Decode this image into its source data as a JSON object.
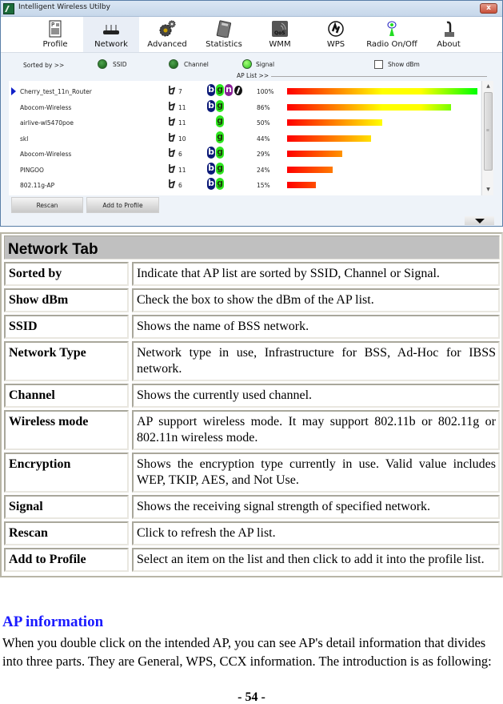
{
  "window": {
    "title": "Intelligent Wireless Utilby",
    "close_label": "x"
  },
  "toolbar": {
    "items": [
      {
        "label": "Profile",
        "icon": "profile-icon"
      },
      {
        "label": "Network",
        "icon": "router-icon",
        "active": true
      },
      {
        "label": "Advanced",
        "icon": "gears-icon"
      },
      {
        "label": "Statistics",
        "icon": "calculator-icon"
      },
      {
        "label": "WMM",
        "icon": "qos-icon"
      },
      {
        "label": "WPS",
        "icon": "wps-icon"
      },
      {
        "label": "Radio On/Off",
        "icon": "radio-antenna-icon"
      },
      {
        "label": "About",
        "icon": "about-icon"
      }
    ]
  },
  "sortbar": {
    "sorted_by_label": "Sorted by >>",
    "options": [
      {
        "label": "SSID",
        "selected": false
      },
      {
        "label": "Channel",
        "selected": false
      },
      {
        "label": "Signal",
        "selected": true
      }
    ],
    "show_dbm_label": "Show dBm",
    "show_dbm_checked": false,
    "ap_list_label": "AP List >>"
  },
  "ap_list": [
    {
      "ssid": "Cherry_test_11n_Router",
      "channel": "7",
      "modes": [
        "b",
        "g",
        "n"
      ],
      "secured": true,
      "signal_pct": 100,
      "signal_label": "100%",
      "selected": true
    },
    {
      "ssid": "Abocom-Wireless",
      "channel": "11",
      "modes": [
        "b",
        "g"
      ],
      "secured": false,
      "signal_pct": 86,
      "signal_label": "86%"
    },
    {
      "ssid": "airlive-wl5470poe",
      "channel": "11",
      "modes": [
        "g"
      ],
      "secured": false,
      "signal_pct": 50,
      "signal_label": "50%"
    },
    {
      "ssid": "skl",
      "channel": "10",
      "modes": [
        "g"
      ],
      "secured": false,
      "signal_pct": 44,
      "signal_label": "44%"
    },
    {
      "ssid": "Abocom-Wireless",
      "channel": "6",
      "modes": [
        "b",
        "g"
      ],
      "secured": false,
      "signal_pct": 29,
      "signal_label": "29%"
    },
    {
      "ssid": "PINGOO",
      "channel": "11",
      "modes": [
        "b",
        "g"
      ],
      "secured": false,
      "signal_pct": 24,
      "signal_label": "24%"
    },
    {
      "ssid": "802.11g-AP",
      "channel": "6",
      "modes": [
        "b",
        "g"
      ],
      "secured": false,
      "signal_pct": 15,
      "signal_label": "15%"
    }
  ],
  "buttons": {
    "rescan": "Rescan",
    "add_to_profile": "Add to Profile"
  },
  "table": {
    "title": "Network Tab",
    "rows": [
      {
        "key": "Sorted by",
        "value": "Indicate that AP list are sorted by SSID, Channel or Signal."
      },
      {
        "key": "Show dBm",
        "value": "Check the box to show the dBm of the AP list."
      },
      {
        "key": "SSID",
        "value": "Shows the name of BSS network."
      },
      {
        "key": "Network Type",
        "value": "Network type in use, Infrastructure for BSS, Ad-Hoc for IBSS network."
      },
      {
        "key": "Channel",
        "value": "Shows the currently used channel."
      },
      {
        "key": "Wireless mode",
        "value": "AP support wireless mode. It may support 802.11b or 802.11g or 802.11n wireless mode."
      },
      {
        "key": "Encryption",
        "value": "Shows the encryption type currently in use. Valid value includes WEP, TKIP, AES, and Not Use."
      },
      {
        "key": "Signal",
        "value": "Shows the receiving signal strength of specified network."
      },
      {
        "key": "Rescan",
        "value": "Click to refresh the AP list."
      },
      {
        "key": "Add to Profile",
        "value": "Select an item on the list and then click to add it into the profile list."
      }
    ]
  },
  "section": {
    "title": "AP information",
    "body": "When you double click on the intended AP, you can see AP's detail information that divides into three parts. They are General, WPS, CCX information. The introduction is as following:"
  },
  "page_number": "- 54 -",
  "colors": {
    "section_title": "#1a1aff",
    "badge_b": "#0c1a78",
    "badge_g": "#2ee61f",
    "badge_n": "#8a1f96",
    "signal_low": "#ff0000",
    "signal_mid": "#ffff00",
    "signal_high": "#00ff00"
  }
}
